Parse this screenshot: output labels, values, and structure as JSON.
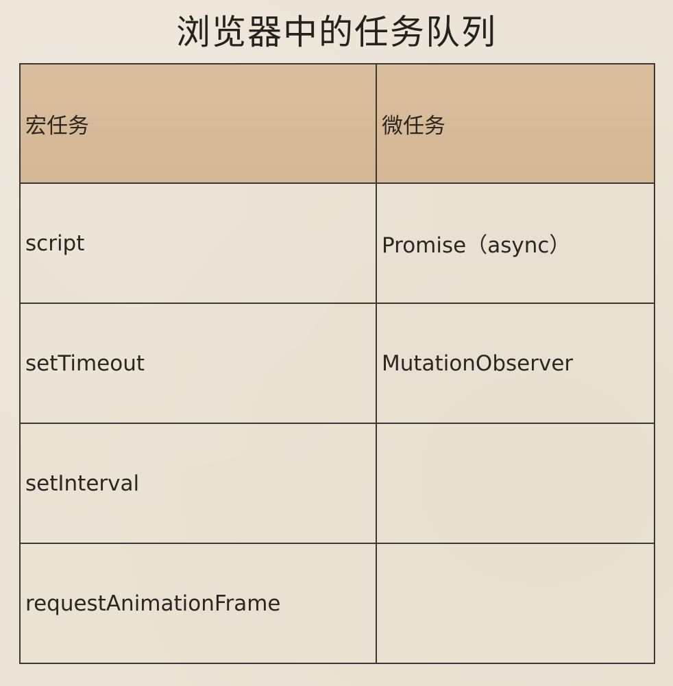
{
  "title": "浏览器中的任务队列",
  "table": {
    "headers": [
      "宏任务",
      "微任务"
    ],
    "rows": [
      [
        "script",
        "Promise（async）"
      ],
      [
        "setTimeout",
        "MutationObserver"
      ],
      [
        "setInterval",
        ""
      ],
      [
        "requestAnimationFrame",
        ""
      ]
    ]
  }
}
